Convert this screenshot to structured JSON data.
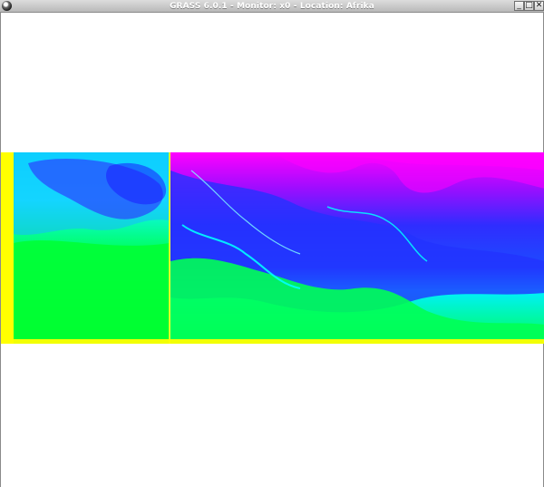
{
  "window": {
    "title": "GRASS 6.0.1 - Monitor: x0 - Location: Afrika",
    "buttons": {
      "minimize": "_",
      "maximize": "□",
      "close": "✕"
    }
  },
  "raster": {
    "colors": {
      "yellow": "#ffff00",
      "green": "#00ff33",
      "cyan": "#00ffff",
      "blue": "#2b2bff",
      "magenta": "#ff00ff",
      "white": "#ffffff"
    }
  }
}
